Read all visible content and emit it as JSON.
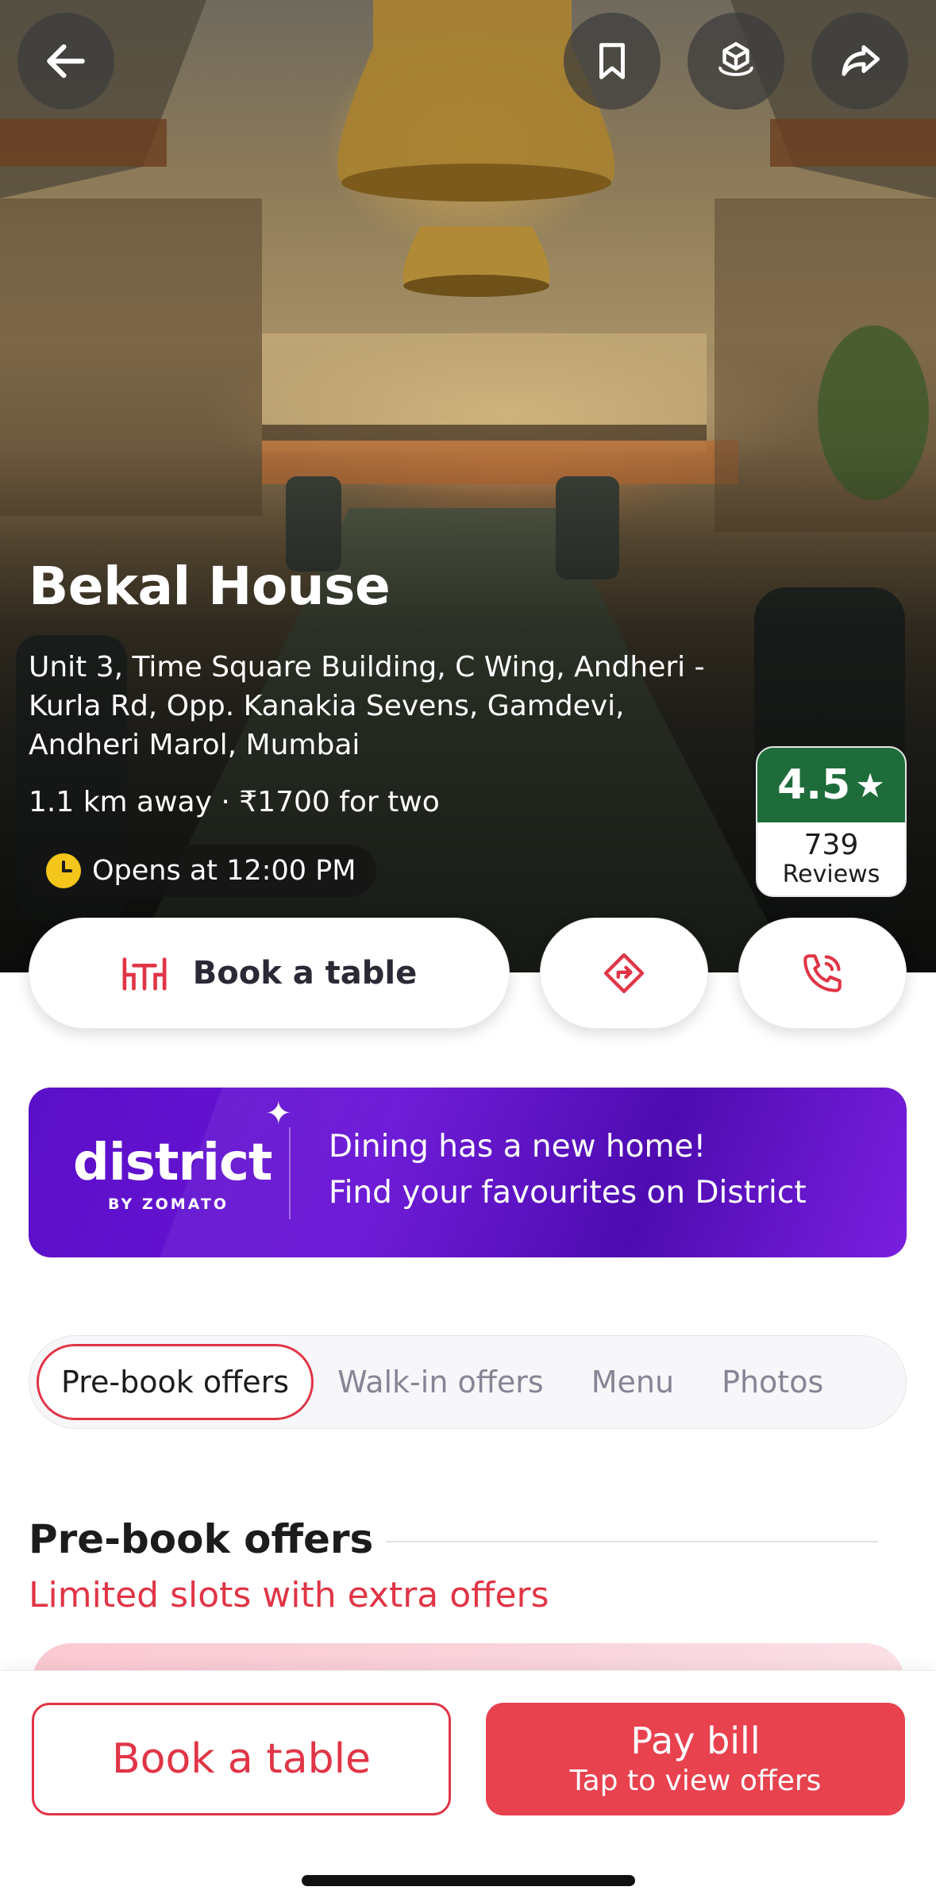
{
  "restaurant": {
    "name": "Bekal House",
    "address": "Unit 3, Time Square Building, C Wing, Andheri - Kurla Rd, Opp. Kanakia Sevens, Gamdevi, Andheri Marol, Mumbai",
    "meta": "1.1 km away · ₹1700 for two",
    "opens": "Opens at 12:00 PM"
  },
  "rating": {
    "value": "4.5",
    "star": "★",
    "count": "739",
    "label": "Reviews",
    "color": "#1e6c3a"
  },
  "actions": {
    "book_label": "Book a table"
  },
  "banner": {
    "logo": "district",
    "by": "BY ZOMATO",
    "sparkle": "✦",
    "line1": "Dining has a new home!",
    "line2": "Find your favourites on District"
  },
  "tabs": [
    {
      "label": "Pre-book offers",
      "active": true
    },
    {
      "label": "Walk-in offers",
      "active": false
    },
    {
      "label": "Menu",
      "active": false
    },
    {
      "label": "Photos",
      "active": false
    }
  ],
  "section": {
    "title": "Pre-book offers",
    "subtitle": "Limited slots with extra offers"
  },
  "bottom": {
    "book_label": "Book a table",
    "pay_label": "Pay bill",
    "pay_sub": "Tap to view offers"
  },
  "icons": {
    "back": "arrow-left-icon",
    "bookmark": "bookmark-icon",
    "ar": "3d-cube-icon",
    "share": "share-icon",
    "table": "table-chairs-icon",
    "direction": "direction-icon",
    "call": "phone-icon",
    "clock": "clock-icon"
  },
  "colors": {
    "accent": "#e03546",
    "pay": "#e8424f",
    "district": "#5a0fc8"
  }
}
